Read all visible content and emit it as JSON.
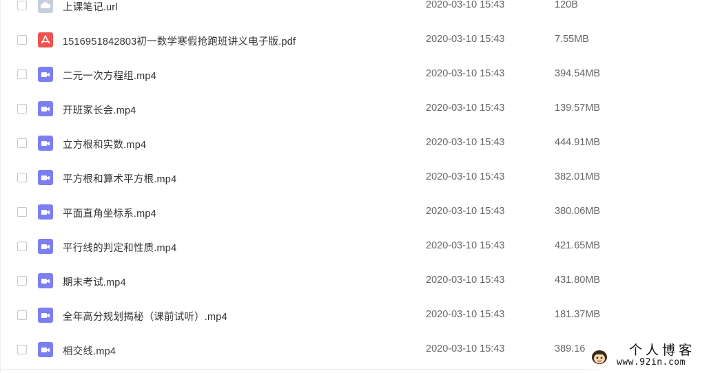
{
  "files": [
    {
      "name": "上课笔记.url",
      "date": "2020-03-10 15:43",
      "size": "120B",
      "icon": "cloud-link-icon"
    },
    {
      "name": "1516951842803初一数学寒假抢跑班讲义电子版.pdf",
      "date": "2020-03-10 15:43",
      "size": "7.55MB",
      "icon": "pdf-icon"
    },
    {
      "name": "二元一次方程组.mp4",
      "date": "2020-03-10 15:43",
      "size": "394.54MB",
      "icon": "video-icon"
    },
    {
      "name": "开班家长会.mp4",
      "date": "2020-03-10 15:43",
      "size": "139.57MB",
      "icon": "video-icon"
    },
    {
      "name": "立方根和实数.mp4",
      "date": "2020-03-10 15:43",
      "size": "444.91MB",
      "icon": "video-icon"
    },
    {
      "name": "平方根和算术平方根.mp4",
      "date": "2020-03-10 15:43",
      "size": "382.01MB",
      "icon": "video-icon"
    },
    {
      "name": "平面直角坐标系.mp4",
      "date": "2020-03-10 15:43",
      "size": "380.06MB",
      "icon": "video-icon"
    },
    {
      "name": "平行线的判定和性质.mp4",
      "date": "2020-03-10 15:43",
      "size": "421.65MB",
      "icon": "video-icon"
    },
    {
      "name": "期末考试.mp4",
      "date": "2020-03-10 15:43",
      "size": "431.80MB",
      "icon": "video-icon"
    },
    {
      "name": "全年高分规划揭秘（课前试听）.mp4",
      "date": "2020-03-10 15:43",
      "size": "181.37MB",
      "icon": "video-icon"
    },
    {
      "name": "相交线.mp4",
      "date": "2020-03-10 15:43",
      "size": "389.16",
      "icon": "video-icon"
    }
  ],
  "watermark": {
    "title": "个人博客",
    "url": "www.92in.com"
  },
  "colors": {
    "video_icon": "#7b7ff2",
    "pdf_icon": "#f0534f",
    "cloud_icon": "#c6cfdc"
  }
}
